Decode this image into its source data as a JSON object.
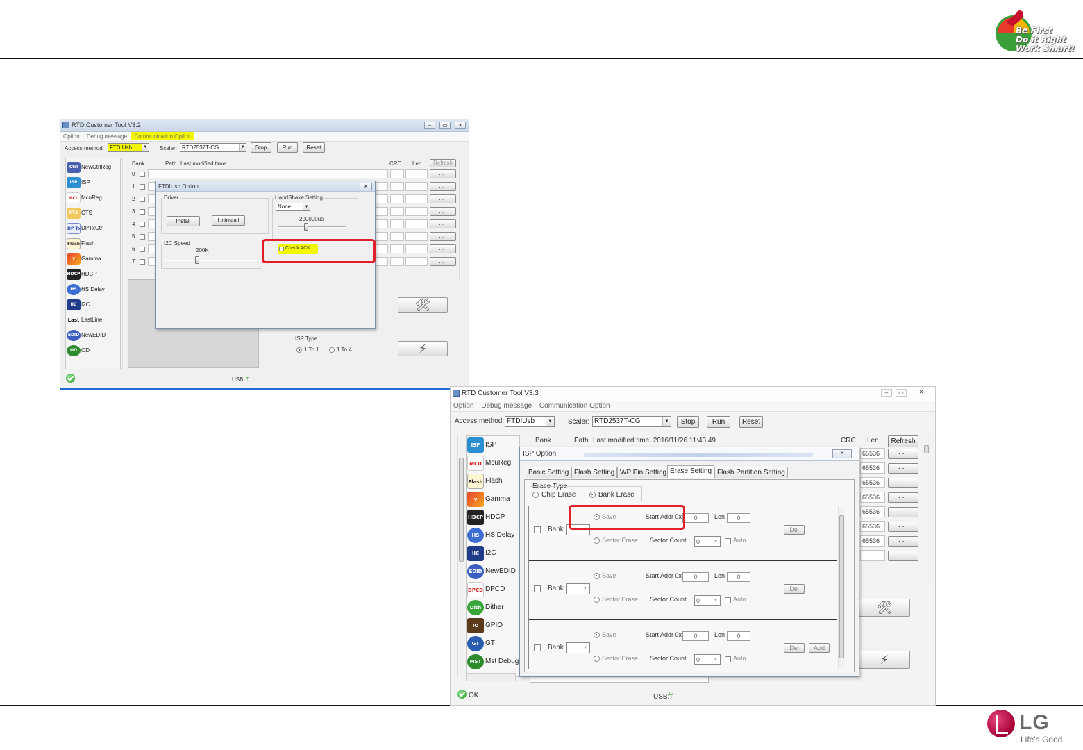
{
  "slide": {
    "top_logo": {
      "slogan_line1": "Be First",
      "slogan_line2": "Do it Right",
      "slogan_line3": "Work Smart!"
    },
    "bottom_logo": {
      "brand": "LG",
      "tagline": "Life's Good"
    }
  },
  "window1": {
    "title": "RTD Customer Tool V3.2",
    "menu": [
      "Option",
      "Debug message",
      "Communication Option"
    ],
    "access_method_label": "Access method:",
    "access_method_value": "FTDIUsb",
    "scaler_label": "Scaler:",
    "scaler_value": "RTD2537T-CG",
    "buttons": {
      "stop": "Stop",
      "run": "Run",
      "reset": "Reset",
      "refresh": "Refresh"
    },
    "table_headers": {
      "bank": "Bank",
      "path": "Path",
      "last_modified": "Last modified time:",
      "crc": "CRC",
      "len": "Len"
    },
    "bank_numbers": [
      "0",
      "1",
      "2",
      "3",
      "4",
      "5",
      "6",
      "7"
    ],
    "row_button_label": ". . .",
    "left_items": [
      "NewCtrlReg",
      "ISP",
      "McuReg",
      "CTS",
      "DPTxCtrl",
      "Flash",
      "Gamma",
      "HDCP",
      "HS Delay",
      "I2C",
      "LastLine",
      "NewEDID",
      "OD"
    ],
    "isp_type_label": "ISP Type",
    "isp_type_options": [
      "1 To 1",
      "1 To 4"
    ],
    "usb_label": "USB:",
    "dialog": {
      "title": "FTDIUsb Option",
      "driver_label": "Driver",
      "install": "Install",
      "uninstall": "Uninstall",
      "handshake_label": "HandShake Setting",
      "handshake_value": "None",
      "handshake_speed": "200000us",
      "i2c_speed_label": "I2C Speed",
      "i2c_speed_value": "200K",
      "check_ack": "Check ACK"
    }
  },
  "window2": {
    "title": "RTD Customer Tool V3.3",
    "menu": [
      "Option",
      "Debug message",
      "Communication Option"
    ],
    "access_method_label": "Access method:",
    "access_method_value": "FTDIUsb",
    "scaler_label": "Scaler:",
    "scaler_value": "RTD2537T-CG",
    "buttons": {
      "stop": "Stop",
      "run": "Run",
      "reset": "Reset",
      "refresh": "Refresh"
    },
    "table_headers": {
      "bank": "Bank",
      "path": "Path",
      "last_modified": "Last modified time: 2016/11/26 11:43:49",
      "crc": "CRC",
      "len": "Len"
    },
    "len_values": [
      "65536",
      "65536",
      "65536",
      "65536",
      "65536",
      "65536",
      "65536",
      ""
    ],
    "row_button_label": ". . .",
    "left_items": [
      "ISP",
      "McuReg",
      "Flash",
      "Gamma",
      "HDCP",
      "HS Delay",
      "I2C",
      "NewEDID",
      "DPCD",
      "Dither",
      "GPIO",
      "GT",
      "Mst Debug"
    ],
    "status_ok": "OK",
    "usb_label": "USB:",
    "dialog": {
      "title": "ISP Option",
      "tabs": [
        "Basic Setting",
        "Flash Setting",
        "WP Pin Setting",
        "Erase Setting",
        "Flash Partition Setting"
      ],
      "active_tab": "Erase Setting",
      "erase_type_label": "Erase Type",
      "erase_options": [
        "Chip Erase",
        "Bank Erase"
      ],
      "rows": [
        {
          "bank_label": "Bank",
          "save": "Save",
          "start_addr_label": "Start Addr 0x",
          "start_addr": "0",
          "len_label": "Len",
          "len": "0",
          "sector_erase": "Sector Erase",
          "sector_count_label": "Sector Count",
          "sector_count": "0",
          "auto": "Auto",
          "del": "Del"
        },
        {
          "bank_label": "Bank",
          "save": "Save",
          "start_addr_label": "Start Addr 0x",
          "start_addr": "0",
          "len_label": "Len",
          "len": "0",
          "sector_erase": "Sector Erase",
          "sector_count_label": "Sector Count",
          "sector_count": "0",
          "auto": "Auto",
          "del": "Del"
        },
        {
          "bank_label": "Bank",
          "save": "Save",
          "start_addr_label": "Start Addr 0x",
          "start_addr": "0",
          "len_label": "Len",
          "len": "0",
          "sector_erase": "Sector Erase",
          "sector_count_label": "Sector Count",
          "sector_count": "0",
          "auto": "Auto",
          "del": "Del",
          "add": "Add"
        }
      ]
    }
  },
  "colors": {
    "highlight": "#f3f700",
    "callout": "#e0202a",
    "lg_red": "#a50034"
  }
}
